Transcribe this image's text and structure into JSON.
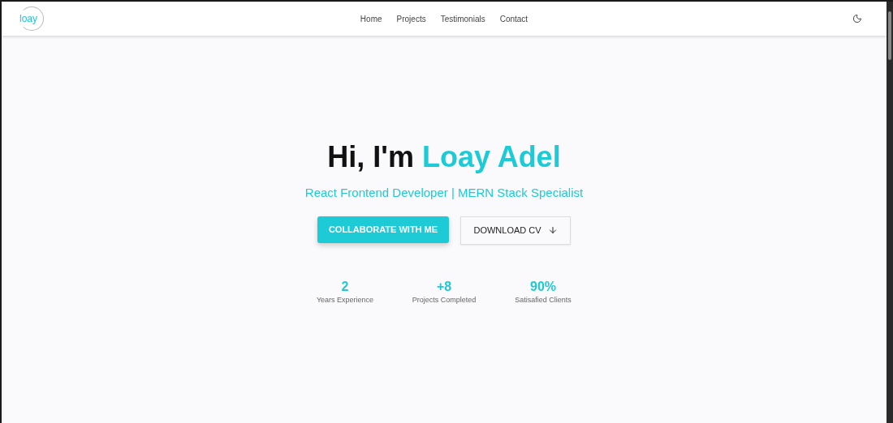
{
  "logo": {
    "text": "loay"
  },
  "nav": {
    "links": [
      "Home",
      "Projects",
      "Testimonials",
      "Contact"
    ]
  },
  "hero": {
    "greeting": "Hi, I'm",
    "name": "Loay Adel",
    "subtitle": "React Frontend Developer | MERN Stack Specialist",
    "buttons": [
      {
        "kind": "primary",
        "label": "COLLABORATE WITH ME"
      },
      {
        "kind": "outline",
        "label": "DOWNLOAD CV"
      }
    ],
    "stats": [
      {
        "value": "2",
        "label": "Years Experience"
      },
      {
        "value": "+8",
        "label": "Projects Completed"
      },
      {
        "value": "90%",
        "label": "Satisafied Clients"
      }
    ]
  }
}
